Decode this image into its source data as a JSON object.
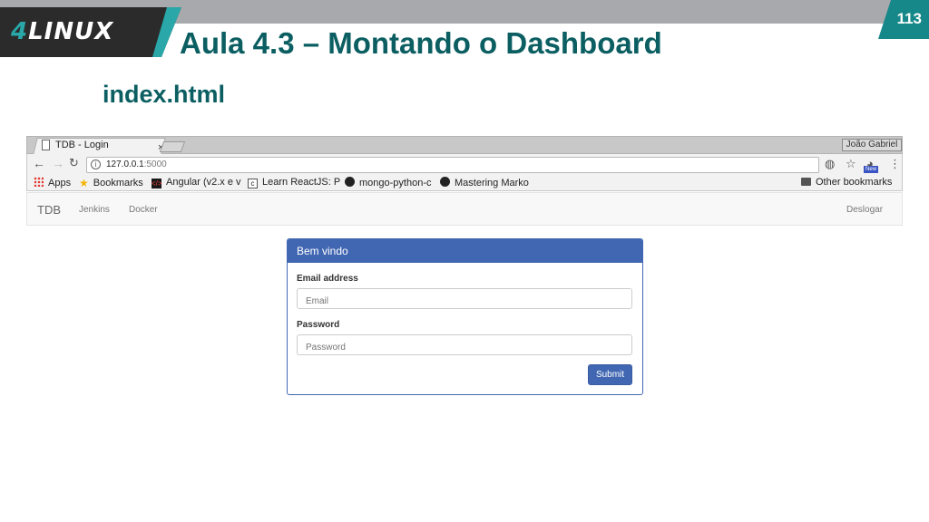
{
  "slide": {
    "logo_prefix": "4",
    "logo_name": "LINUX",
    "title": "Aula 4.3 – Montando o Dashboard",
    "page_number": "113",
    "subtitle": "index.html",
    "colors": {
      "title": "#0b5e61",
      "accent": "#17888a",
      "bar": "#a7a9ac"
    }
  },
  "browser": {
    "tab": {
      "title": "TDB - Login",
      "icon": "document-icon",
      "close": "×"
    },
    "profile_name": "João Gabriel",
    "address": {
      "host": "127.0.0.1",
      "port": ":5000"
    },
    "toolbar_icons": [
      "back-icon",
      "forward-icon",
      "reload-icon",
      "info-icon",
      "extension-icon",
      "star-icon",
      "extension-new-icon",
      "menu-icon"
    ],
    "new_badge": "New",
    "bookmarks": [
      {
        "label": "Apps",
        "icon": "apps-icon"
      },
      {
        "label": "Bookmarks",
        "icon": "star-icon"
      },
      {
        "label": "Angular (v2.x e v",
        "icon": "angular-icon"
      },
      {
        "label": "Learn ReactJS: P",
        "icon": "react-doc-icon"
      },
      {
        "label": "mongo-python-c",
        "icon": "github-icon"
      },
      {
        "label": "Mastering Marko",
        "icon": "github-icon"
      }
    ],
    "other_bookmarks": "Other bookmarks"
  },
  "page": {
    "navbar": {
      "brand": "TDB",
      "links": [
        "Jenkins",
        "Docker"
      ],
      "logout": "Deslogar"
    },
    "login": {
      "heading": "Bem vindo",
      "email_label": "Email address",
      "email_placeholder": "Email",
      "password_label": "Password",
      "password_placeholder": "Password",
      "submit": "Submit",
      "color": "#4267b2"
    }
  }
}
